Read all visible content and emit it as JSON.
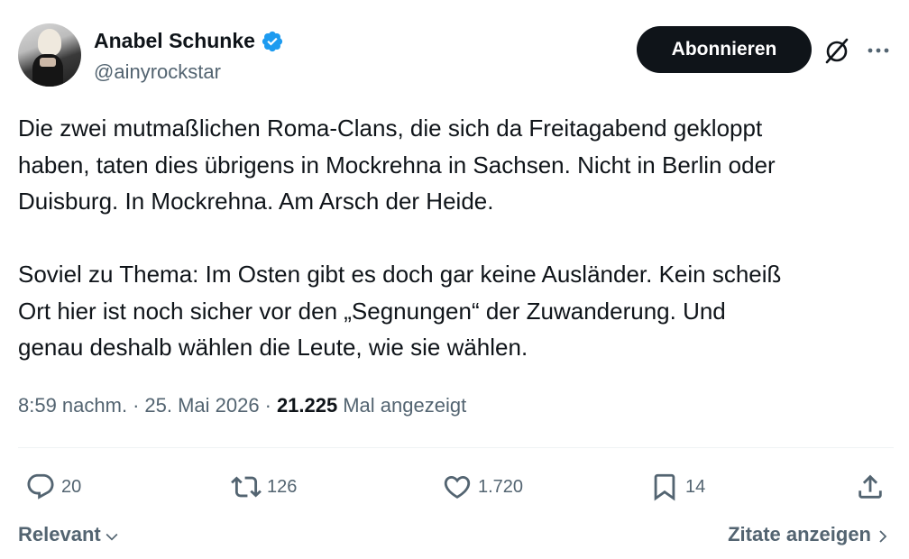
{
  "author": {
    "display_name": "Anabel Schunke",
    "handle": "@ainyrockstar",
    "verified": true
  },
  "header": {
    "follow_label": "Abonnieren",
    "icons": [
      "grok-icon",
      "more-icon"
    ]
  },
  "tweet": {
    "text": "Die zwei mutmaßlichen Roma-Clans, die sich da Freitagabend gekloppt\nhaben, taten dies übrigens in Mockrehna in Sachsen. Nicht in Berlin oder\nDuisburg. In Mockrehna. Am Arsch der Heide.\n\nSoviel zu Thema: Im Osten gibt es doch gar keine Ausländer. Kein scheiß\nOrt hier ist noch sicher vor den „Segnungen“ der Zuwanderung. Und\ngenau deshalb wählen die Leute, wie sie wählen."
  },
  "meta": {
    "time": "8:59 nachm.",
    "separator": "·",
    "date": "25. Mai 2026",
    "views_count": "21.225",
    "views_label": "Mal angezeigt"
  },
  "actions": {
    "replies": "20",
    "retweets": "126",
    "likes": "1.720",
    "bookmarks": "14"
  },
  "footer": {
    "sort_label": "Relevant",
    "quotes_label": "Zitate anzeigen"
  },
  "colors": {
    "text": "#0f1419",
    "secondary": "#536471",
    "verified": "#1d9bf0",
    "divider": "#eff3f4"
  }
}
